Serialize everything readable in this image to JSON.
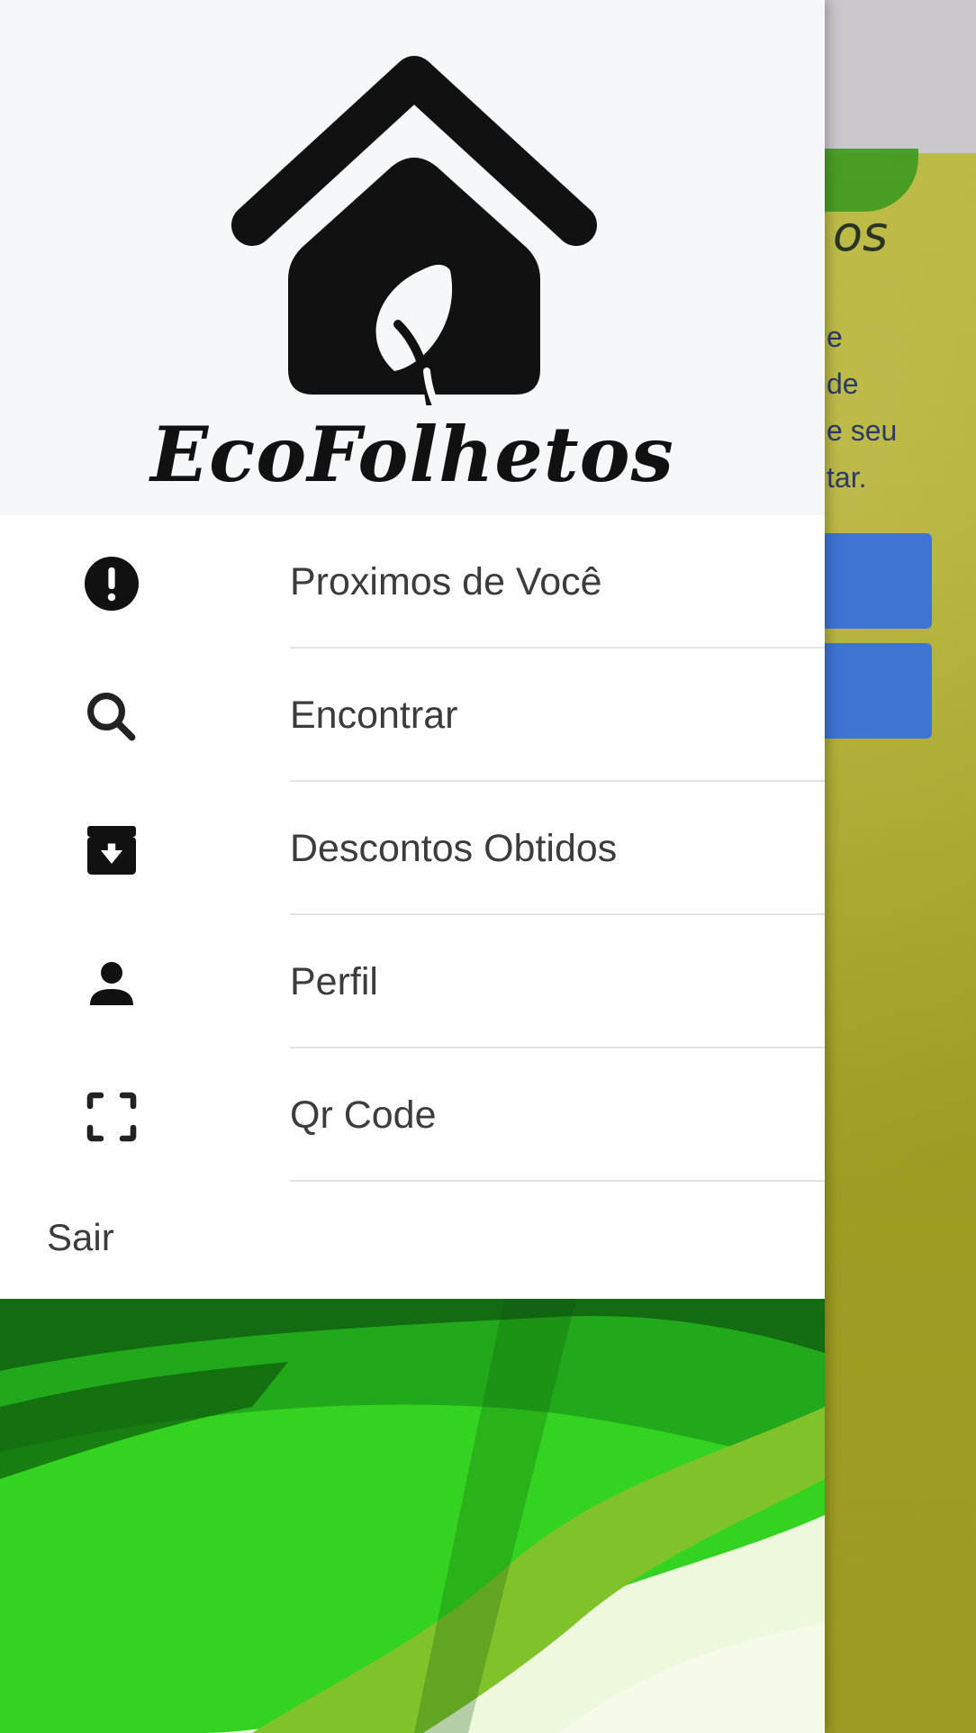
{
  "app": {
    "brand_name": "EcoFolhetos"
  },
  "background_screen": {
    "heading_fragment": "os",
    "body_fragments": [
      "e",
      "de",
      "e seu",
      "tar."
    ]
  },
  "drawer": {
    "menu_items": [
      {
        "label": "Proximos de Você",
        "icon": "alert-circle-icon"
      },
      {
        "label": "Encontrar",
        "icon": "search-icon"
      },
      {
        "label": "Descontos Obtidos",
        "icon": "archive-download-icon"
      },
      {
        "label": "Perfil",
        "icon": "person-icon"
      },
      {
        "label": "Qr Code",
        "icon": "scan-frame-icon"
      }
    ],
    "logout_label": "Sair"
  },
  "colors": {
    "drawer_background": "#ffffff",
    "header_background": "#f6f7f8",
    "text": "#3c3c3c",
    "accent_green": "#2fb51c",
    "background_olive": "#a9a829",
    "background_button_blue": "#3f74d4"
  }
}
